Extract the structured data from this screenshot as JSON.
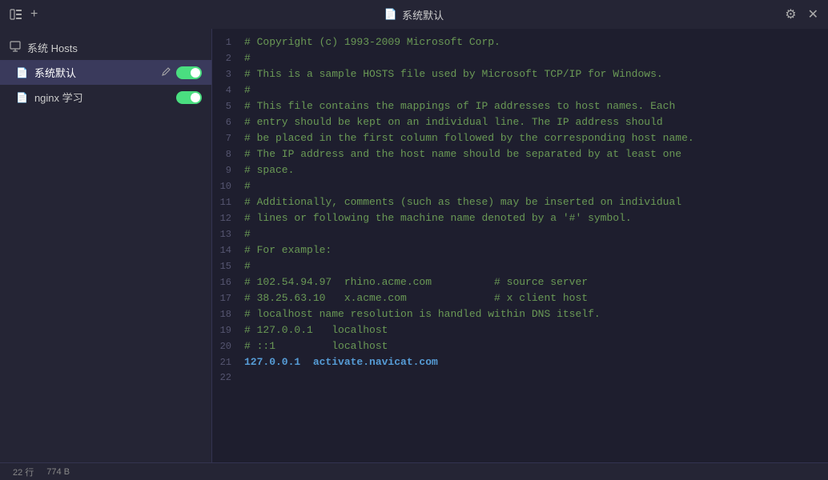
{
  "titleBar": {
    "title": "系统默认",
    "fileIcon": "📄",
    "settingsIcon": "⚙",
    "closeIcon": "✕",
    "addTabIcon": "+"
  },
  "sidebar": {
    "sectionLabel": "系统 Hosts",
    "items": [
      {
        "id": "sys-default",
        "label": "系统默认",
        "active": true,
        "toggleOn": true
      },
      {
        "id": "nginx-study",
        "label": "nginx 学习",
        "active": false,
        "toggleOn": true
      }
    ]
  },
  "editor": {
    "lines": [
      {
        "num": 1,
        "text": "# Copyright (c) 1993-2009 Microsoft Corp.",
        "type": "comment"
      },
      {
        "num": 2,
        "text": "#",
        "type": "comment"
      },
      {
        "num": 3,
        "text": "# This is a sample HOSTS file used by Microsoft TCP/IP for Windows.",
        "type": "comment"
      },
      {
        "num": 4,
        "text": "#",
        "type": "comment"
      },
      {
        "num": 5,
        "text": "# This file contains the mappings of IP addresses to host names. Each",
        "type": "comment"
      },
      {
        "num": 6,
        "text": "# entry should be kept on an individual line. The IP address should",
        "type": "comment"
      },
      {
        "num": 7,
        "text": "# be placed in the first column followed by the corresponding host name.",
        "type": "comment"
      },
      {
        "num": 8,
        "text": "# The IP address and the host name should be separated by at least one",
        "type": "comment"
      },
      {
        "num": 9,
        "text": "# space.",
        "type": "comment"
      },
      {
        "num": 10,
        "text": "#",
        "type": "comment"
      },
      {
        "num": 11,
        "text": "# Additionally, comments (such as these) may be inserted on individual",
        "type": "comment"
      },
      {
        "num": 12,
        "text": "# lines or following the machine name denoted by a '#' symbol.",
        "type": "comment"
      },
      {
        "num": 13,
        "text": "#",
        "type": "comment"
      },
      {
        "num": 14,
        "text": "# For example:",
        "type": "comment"
      },
      {
        "num": 15,
        "text": "#",
        "type": "comment"
      },
      {
        "num": 16,
        "text": "# 102.54.94.97  rhino.acme.com          # source server",
        "type": "comment"
      },
      {
        "num": 17,
        "text": "# 38.25.63.10   x.acme.com              # x client host",
        "type": "comment"
      },
      {
        "num": 18,
        "text": "# localhost name resolution is handled within DNS itself.",
        "type": "comment"
      },
      {
        "num": 19,
        "text": "# 127.0.0.1   localhost",
        "type": "comment"
      },
      {
        "num": 20,
        "text": "# ::1         localhost",
        "type": "comment"
      },
      {
        "num": 21,
        "text": "127.0.0.1  activate.navicat.com",
        "type": "host"
      },
      {
        "num": 22,
        "text": "",
        "type": "normal"
      }
    ]
  },
  "statusBar": {
    "lineInfo": "22 行",
    "sizeInfo": "774 B"
  }
}
